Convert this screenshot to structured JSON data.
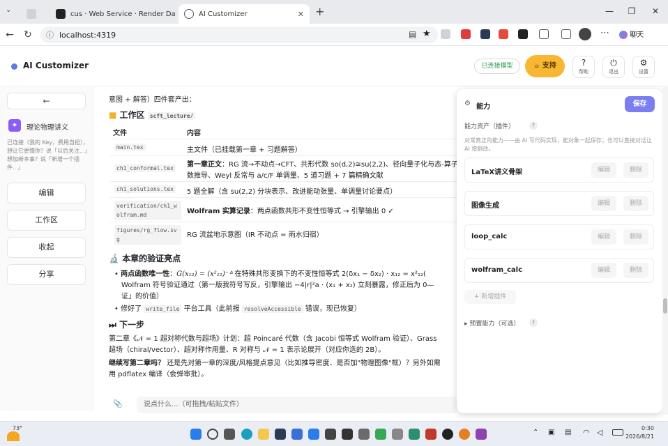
{
  "browser": {
    "tabs": [
      {
        "label": ""
      },
      {
        "label": "cus · Web Service · Render Das"
      },
      {
        "label": "AI Customizer"
      }
    ],
    "url": "localhost:4319",
    "profile_label": "聊天"
  },
  "header": {
    "title": "AI Customizer",
    "connected_label": "已连接模型",
    "support_label": "支持",
    "help_label": "帮助",
    "logout_label": "退出",
    "settings_label": "设置"
  },
  "sidebar": {
    "back": "←",
    "project_name": "理论物理讲义",
    "project_desc": "已连接（我的 Key，费用自担），想让它更懂你？说「以后关注...」想加新本事？说「新增一个插件...」",
    "buttons": [
      "编辑",
      "工作区",
      "收起",
      "分享"
    ]
  },
  "main": {
    "top_line": "意图 + 解答）四件套产出：",
    "workspace_title": "工作区",
    "workspace_code": "scft_lecture/",
    "table": {
      "headers": [
        "文件",
        "内容"
      ],
      "rows": [
        {
          "file": "main.tex",
          "content": "主文件（已挂载第一章 + 习题解答）"
        },
        {
          "file": "ch1_conformal.tex",
          "content_bold": "第一章正文",
          "content": "：RG 流→不动点→CFT、共形代数 so(d,2)≅su(2,2)、径向量子化与态-算子",
          "content2": "数推导、Weyl 反常与 a/c/F 单调量、5 道习题 + 7 篇精确文献"
        },
        {
          "file": "ch1_solutions.tex",
          "content": "5 题全解（含 su(2,2) 分块表示、改进能动张量、单调量讨论要点）"
        },
        {
          "file": "verification/ch1_wolfram.md",
          "content_bold": "Wolfram 实算记录",
          "content": "：两点函数共形不变性恒等式 → 引擎输出 0 ✓"
        },
        {
          "file": "figures/rg_flow.svg",
          "content": "RG 流盆地示意图（IR 不动点 = 雨水归宿）"
        }
      ]
    },
    "highlights_title": "本章的验证亮点",
    "bullet1_bold": "两点函数唯一性",
    "bullet1_math": "G(x₁₂) = (x²₁₂)⁻ᐞ",
    "bullet1_text": "在特殊共形变换下的不变性恒等式 2(δx₁ − δx₂) · x₁₂ = x²₁₂(",
    "bullet1_line2": "Wolfram 符号验证通过（第一版我符号写反，引擎输出 −4|r|²a · (x₁ + x₂) 立刻暴露，修正后为 0—",
    "bullet1_line3": "证」的价值）",
    "bullet2_pre": "修好了",
    "bullet2_code": "write_file",
    "bullet2_mid": "平台工具（此前报",
    "bullet2_code2": "resolveAccessible",
    "bullet2_post": "错误，现已恢复）",
    "next_title": "下一步",
    "next_line1": "第二章《𝒩 = 1 超对称代数与超场》计划：超 Poincaré 代数（含 Jacobi 恒等式 Wolfram 验证）、Grass",
    "next_line2": "超场（chiral/vector）、超对称作用量、R 对称与 𝒩 = 1 表示论展开（对应你选的 2B）。",
    "question_bold": "继续写第二章吗？",
    "question": "还是先对第一章的深度/风格提点意见（比如推导密度、是否加\"物理图像\"框）？另外如需",
    "question2": "用 pdflatex 编译（会弹审批）。"
  },
  "input": {
    "attach": "📎",
    "placeholder": "说点什么...（可拖拽/粘贴文件）"
  },
  "capability_panel": {
    "title": "能力",
    "save": "保存",
    "assets_label": "能力资产（插件）",
    "help": "?",
    "desc": "对常真正的能力——由 AI 写代码实现，能对象一起保存；也可以直接对话让 AI 增删改。",
    "plugins": [
      {
        "name": "LaTeX讲义骨架",
        "edit": "编辑",
        "delete": "删除"
      },
      {
        "name": "图像生成",
        "edit": "编辑",
        "delete": "删除"
      },
      {
        "name": "loop_calc",
        "edit": "编辑",
        "delete": "删除"
      },
      {
        "name": "wolfram_calc",
        "edit": "编辑",
        "delete": "删除"
      }
    ],
    "add_plugin": "+ 新增插件",
    "preset_label": "▸ 预置能力（可选）"
  },
  "taskbar": {
    "weather": "73°",
    "time": "0:30",
    "date": "2026/8/21"
  },
  "colors": {
    "accent": "#7b7ef0",
    "support": "#f7b733",
    "connected": "#2e9b4e",
    "project_icon": "#8b5cf6"
  }
}
